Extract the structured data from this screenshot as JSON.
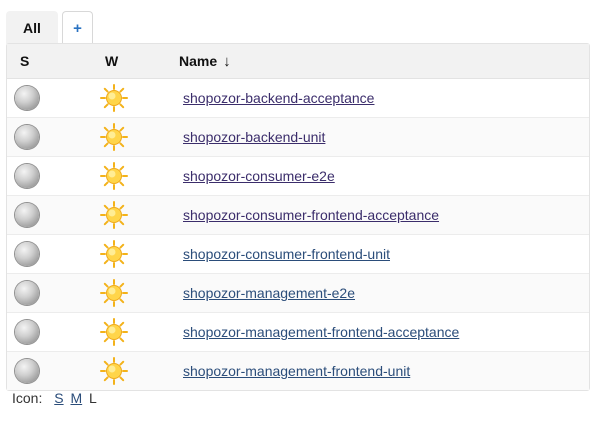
{
  "tabs": [
    {
      "label": "All",
      "active": true
    },
    {
      "label": "+",
      "active": false
    }
  ],
  "table": {
    "headers": {
      "status": "S",
      "weather": "W",
      "name": "Name",
      "sort_indicator": "↓"
    },
    "rows": [
      {
        "status_icon": "status-ball-gray-icon",
        "weather_icon": "sunny-weather-icon",
        "name": "shopozor-backend-acceptance"
      },
      {
        "status_icon": "status-ball-gray-icon",
        "weather_icon": "sunny-weather-icon",
        "name": "shopozor-backend-unit"
      },
      {
        "status_icon": "status-ball-gray-icon",
        "weather_icon": "sunny-weather-icon",
        "name": "shopozor-consumer-e2e"
      },
      {
        "status_icon": "status-ball-gray-icon",
        "weather_icon": "sunny-weather-icon",
        "name": "shopozor-consumer-frontend-acceptance"
      },
      {
        "status_icon": "status-ball-gray-icon",
        "weather_icon": "sunny-weather-icon",
        "name": "shopozor-consumer-frontend-unit"
      },
      {
        "status_icon": "status-ball-gray-icon",
        "weather_icon": "sunny-weather-icon",
        "name": "shopozor-management-e2e"
      },
      {
        "status_icon": "status-ball-gray-icon",
        "weather_icon": "sunny-weather-icon",
        "name": "shopozor-management-frontend-acceptance"
      },
      {
        "status_icon": "status-ball-gray-icon",
        "weather_icon": "sunny-weather-icon",
        "name": "shopozor-management-frontend-unit"
      }
    ]
  },
  "footer": {
    "label": "Icon:",
    "sizes": [
      {
        "label": "S",
        "link": true
      },
      {
        "label": "M",
        "link": true
      },
      {
        "label": "L",
        "link": false
      }
    ]
  },
  "colors": {
    "tab_active_bg": "#f2f2f2",
    "header_bg": "#f2f2f2",
    "link": "#3b2d6b",
    "add_tab": "#2a73c2"
  }
}
